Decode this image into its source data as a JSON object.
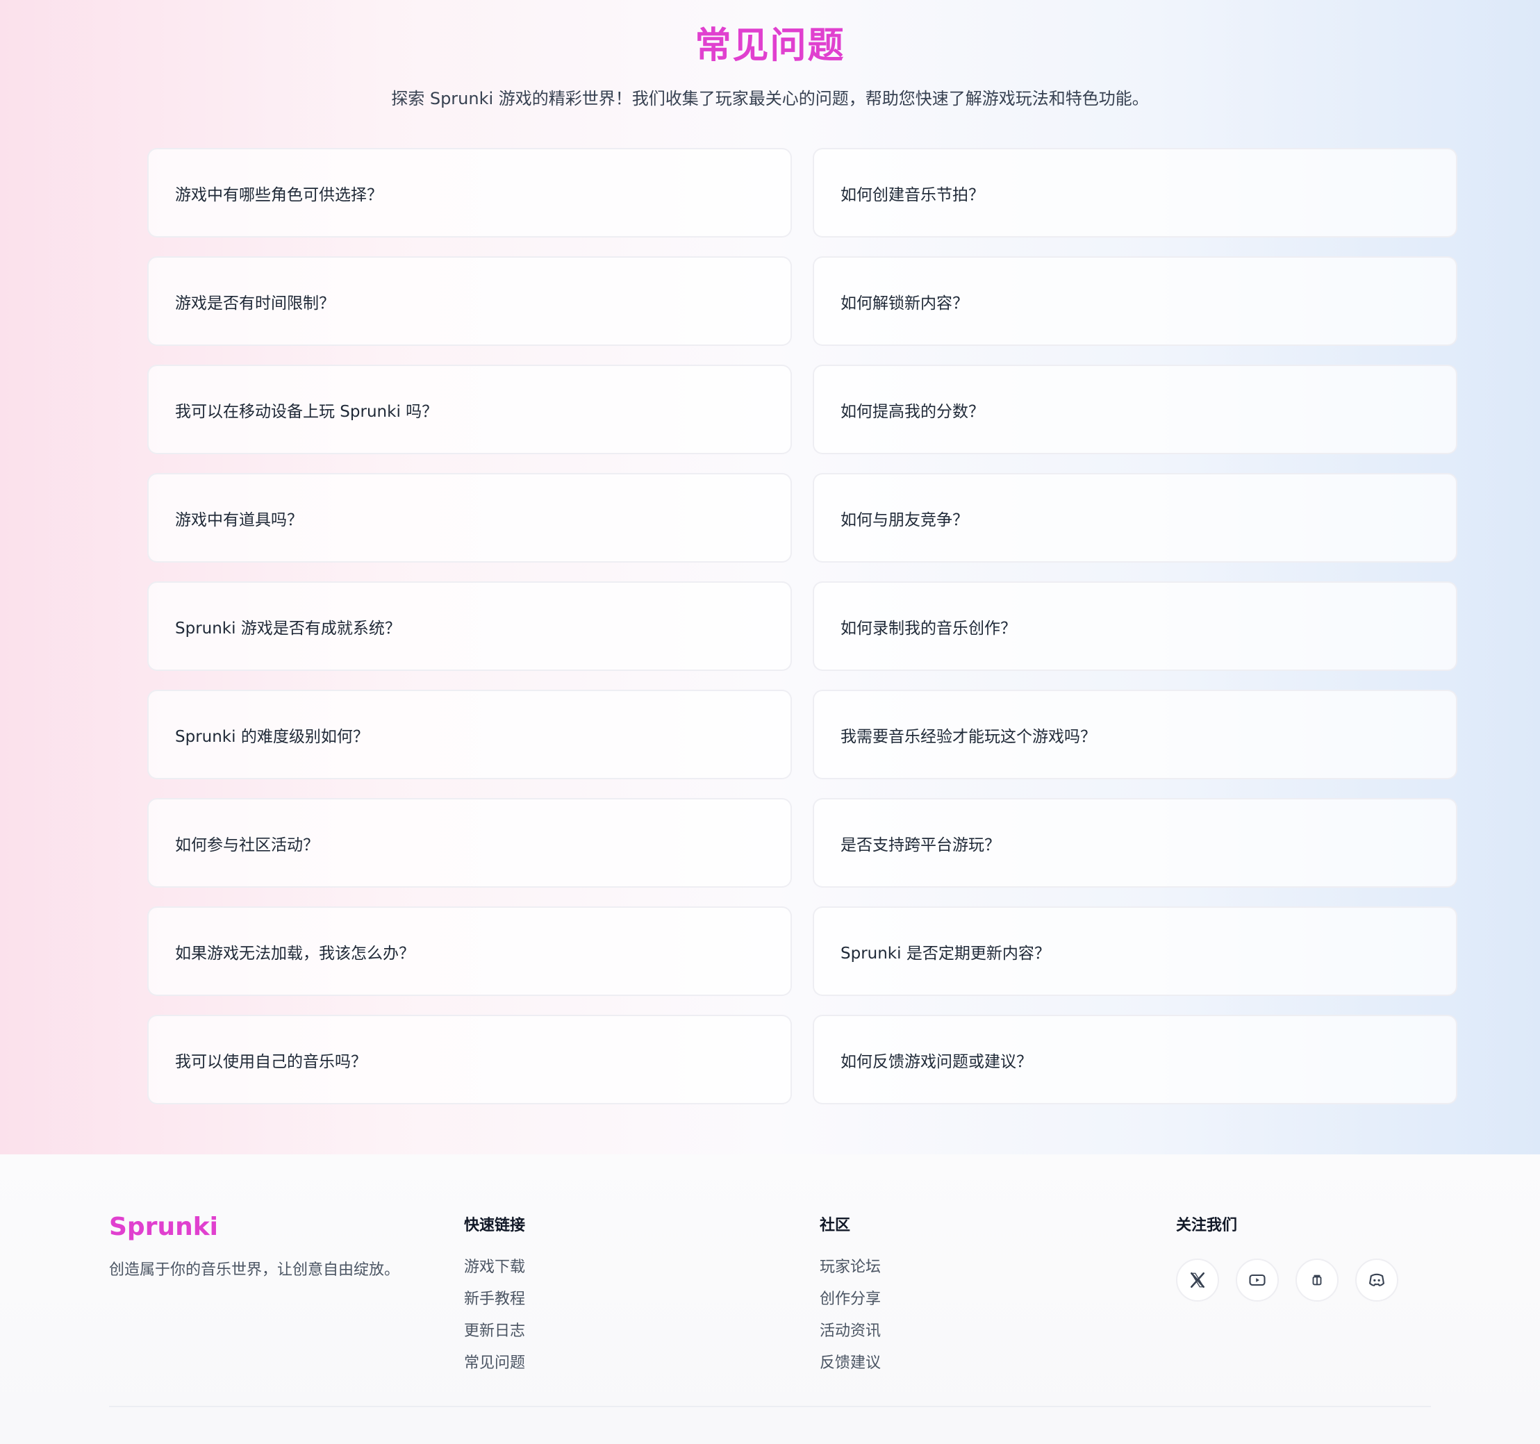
{
  "faq": {
    "title": "常见问题",
    "subtitle": "探索 Sprunki 游戏的精彩世界！我们收集了玩家最关心的问题，帮助您快速了解游戏玩法和特色功能。",
    "items": [
      "游戏中有哪些角色可供选择？",
      "如何创建音乐节拍？",
      "游戏是否有时间限制？",
      "如何解锁新内容？",
      "我可以在移动设备上玩 Sprunki 吗？",
      "如何提高我的分数？",
      "游戏中有道具吗？",
      "如何与朋友竞争？",
      "Sprunki 游戏是否有成就系统？",
      "如何录制我的音乐创作？",
      "Sprunki 的难度级别如何？",
      "我需要音乐经验才能玩这个游戏吗？",
      "如何参与社区活动？",
      "是否支持跨平台游玩？",
      "如果游戏无法加载，我该怎么办？",
      "Sprunki 是否定期更新内容？",
      "我可以使用自己的音乐吗？",
      "如何反馈游戏问题或建议？"
    ]
  },
  "footer": {
    "brand": "Sprunki",
    "tagline": "创造属于你的音乐世界，让创意自由绽放。",
    "quick_links": {
      "title": "快速链接",
      "links": [
        "游戏下载",
        "新手教程",
        "更新日志",
        "常见问题"
      ]
    },
    "community": {
      "title": "社区",
      "links": [
        "玩家论坛",
        "创作分享",
        "活动资讯",
        "反馈建议"
      ]
    },
    "follow": {
      "title": "关注我们",
      "icons": [
        "x-icon",
        "youtube-icon",
        "tiktok-icon",
        "discord-icon"
      ]
    }
  },
  "colors": {
    "accent": "#e040cf",
    "gradient_left": "#fbe1ec",
    "gradient_right": "#dde9f9"
  }
}
